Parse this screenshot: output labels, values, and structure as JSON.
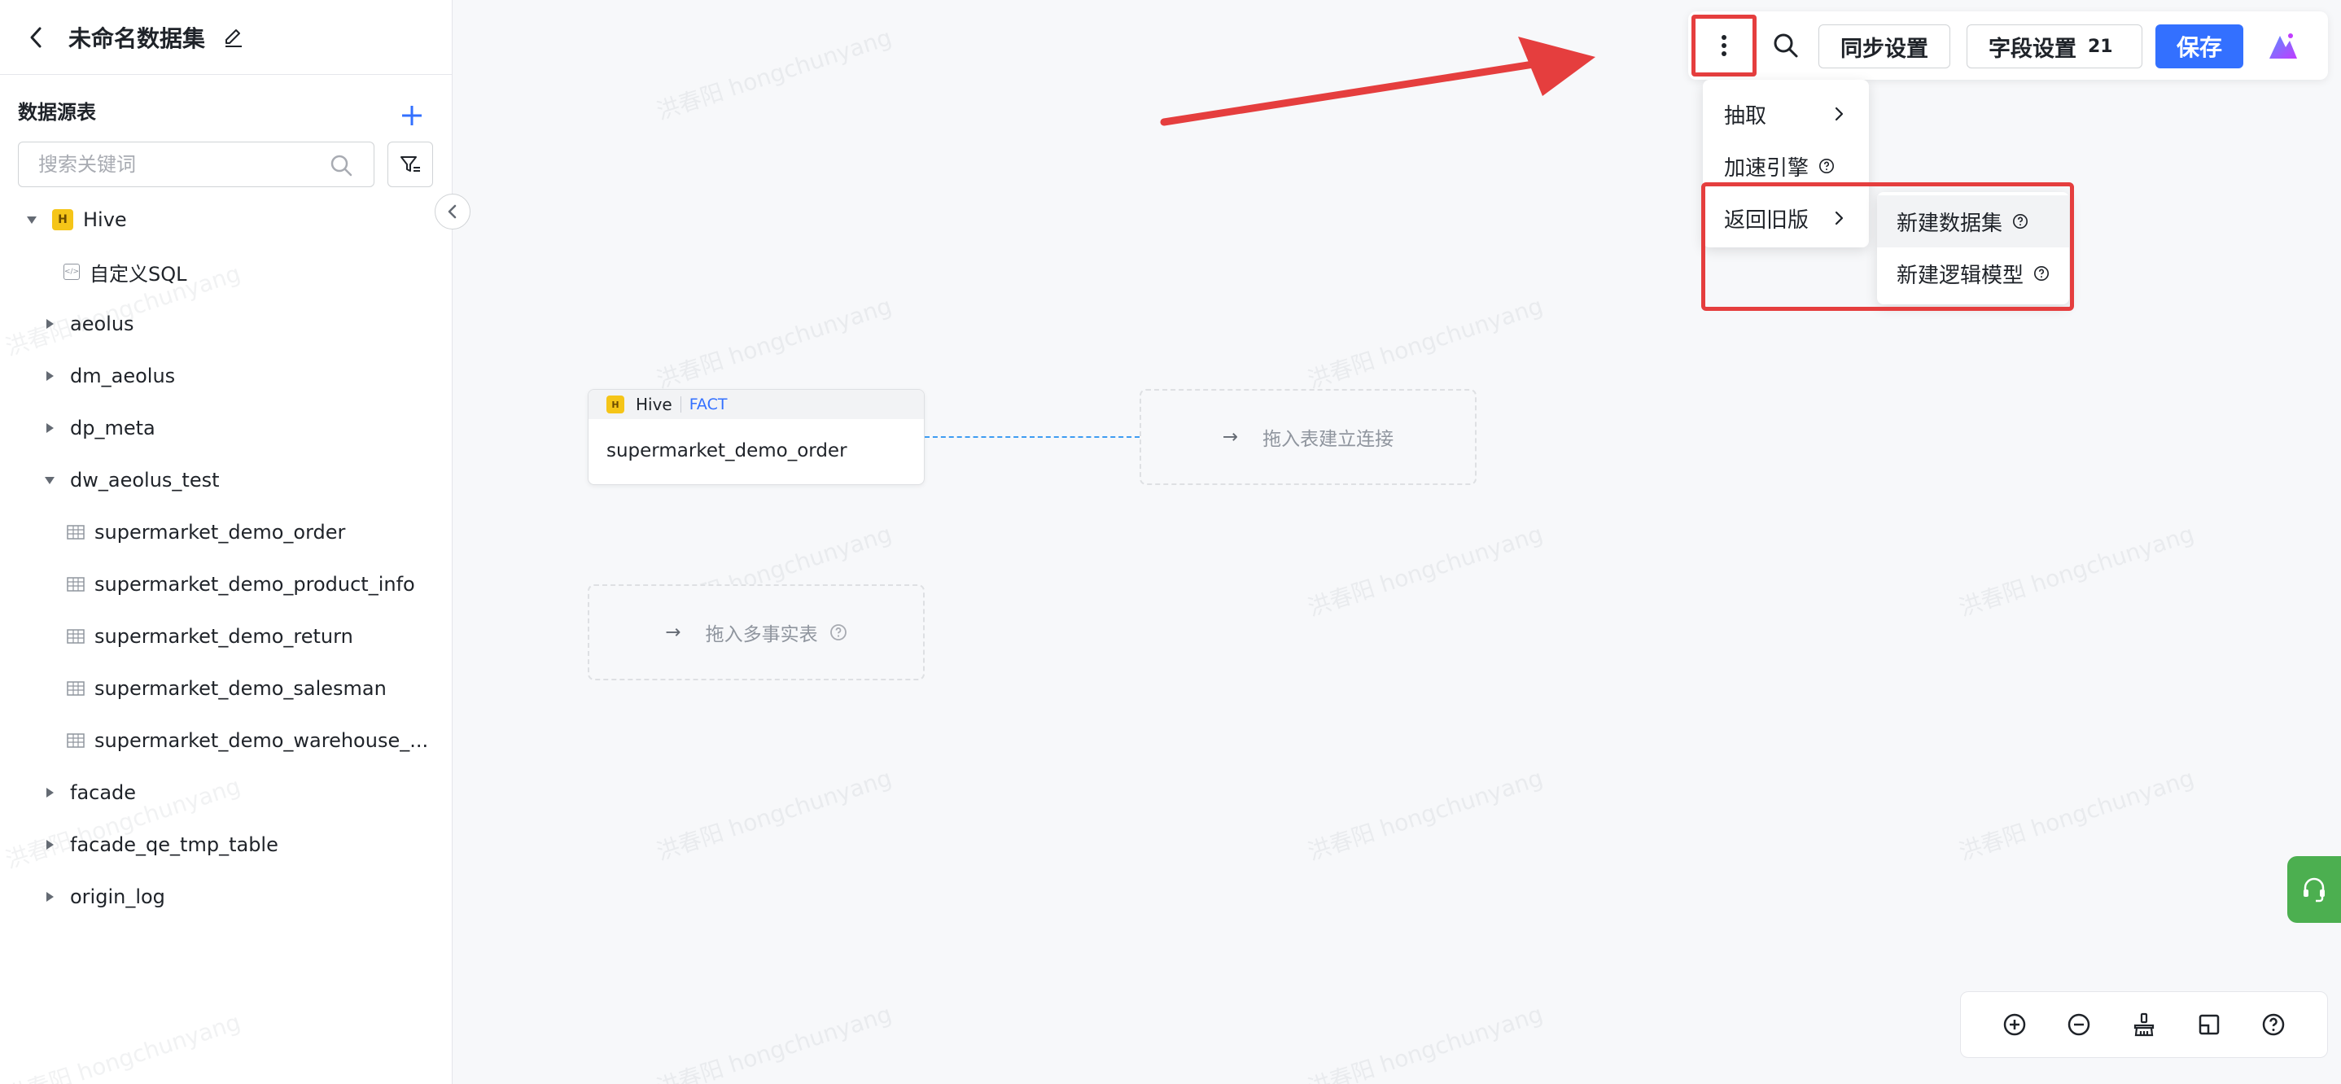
{
  "header": {
    "title": "未命名数据集"
  },
  "sidebar": {
    "section_title": "数据源表",
    "search_placeholder": "搜索关键词",
    "tree": {
      "root": "Hive",
      "custom_sql": "自定义SQL",
      "dbs": [
        "aeolus",
        "dm_aeolus",
        "dp_meta",
        "dw_aeolus_test",
        "facade",
        "facade_qe_tmp_table",
        "origin_log"
      ],
      "tables": [
        "supermarket_demo_order",
        "supermarket_demo_product_info",
        "supermarket_demo_return",
        "supermarket_demo_salesman",
        "supermarket_demo_warehouse_..."
      ]
    }
  },
  "canvas": {
    "fact_node": {
      "source": "Hive",
      "tag": "FACT",
      "table": "supermarket_demo_order"
    },
    "join_placeholder": "拖入表建立连接",
    "multi_fact_placeholder": "拖入多事实表",
    "arrow_glyph": "→"
  },
  "toolbar": {
    "sync_label": "同步设置",
    "fields_label": "字段设置",
    "fields_count": "21",
    "save_label": "保存"
  },
  "menu": {
    "items": [
      "抽取",
      "加速引擎",
      "返回旧版"
    ],
    "submenu": [
      "新建数据集",
      "新建逻辑模型"
    ]
  },
  "watermark": "洪春阳 hongchunyang",
  "colors": {
    "accent": "#3370ff",
    "annotation": "#e53e3e",
    "support": "#4caf50",
    "hive": "#f5c518"
  }
}
